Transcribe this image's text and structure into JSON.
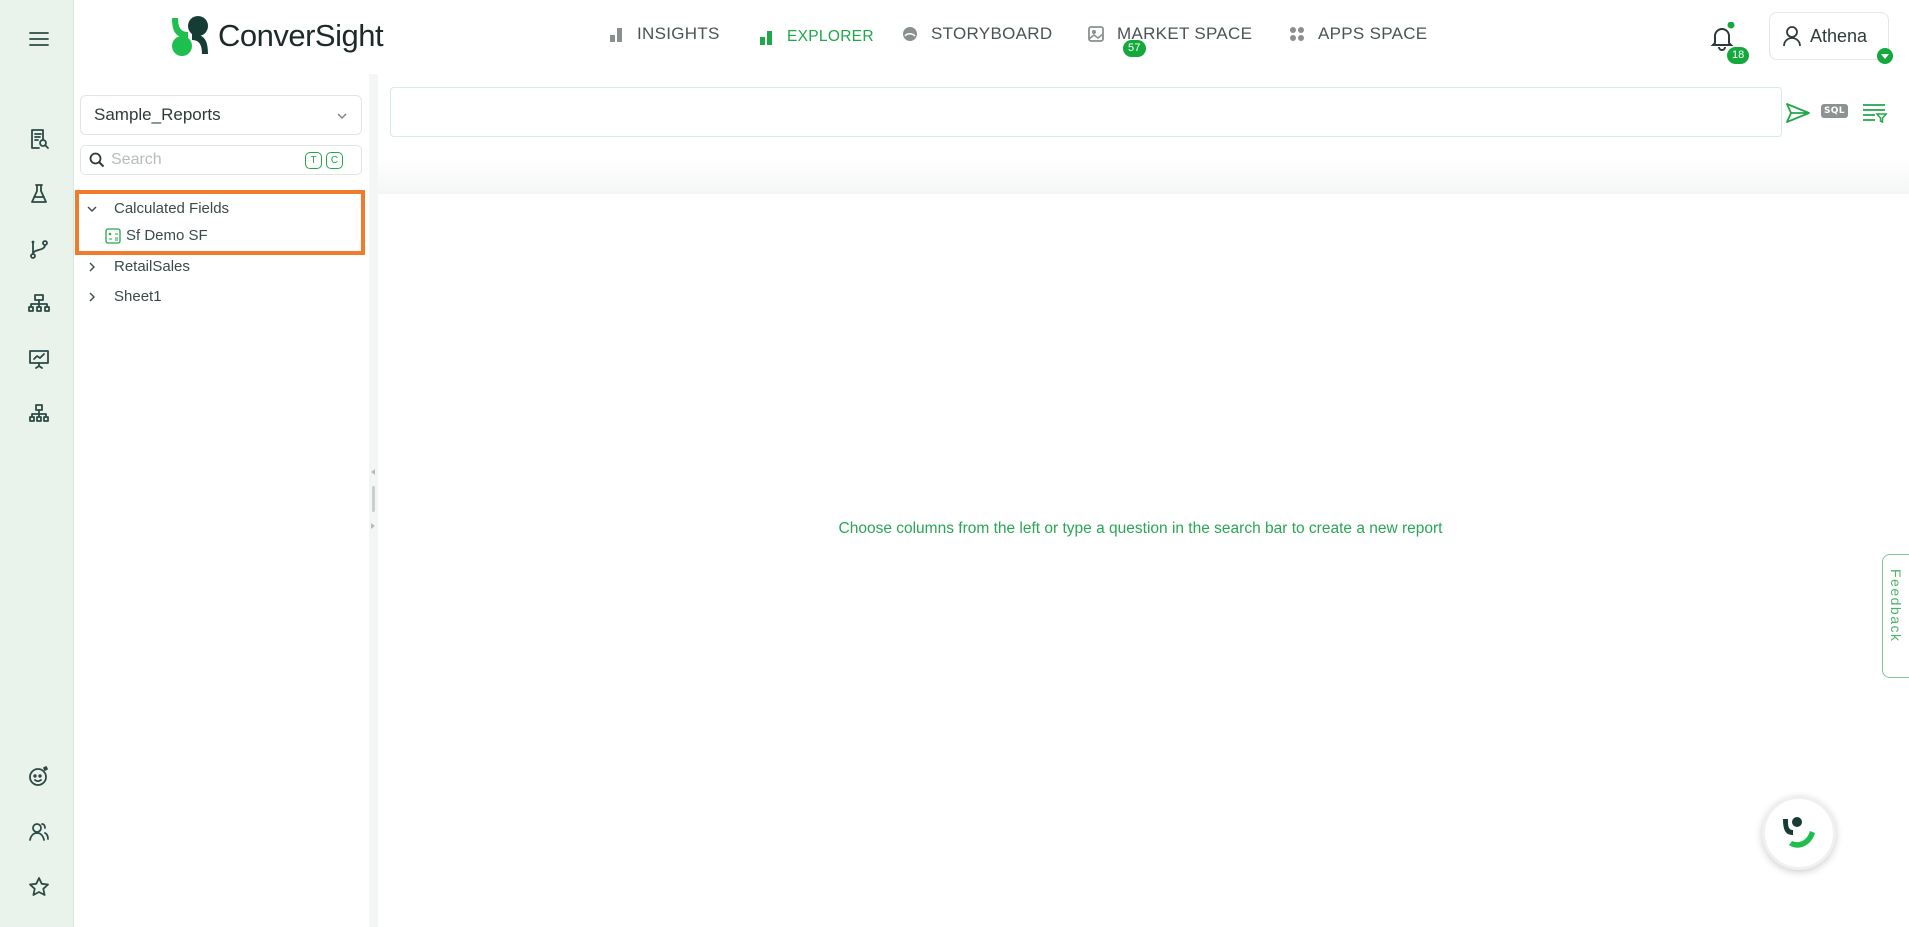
{
  "app": {
    "name": "ConverSight"
  },
  "nav": {
    "items": [
      {
        "label": "INSIGHTS",
        "icon": "bar-chart-icon"
      },
      {
        "label": "EXPLORER",
        "icon": "explorer-chart-icon",
        "active": true
      },
      {
        "label": "STORYBOARD",
        "icon": "storyboard-icon",
        "badge": "57"
      },
      {
        "label": "MARKET SPACE",
        "icon": "market-space-icon"
      },
      {
        "label": "APPS SPACE",
        "icon": "apps-grid-icon"
      }
    ]
  },
  "notifications": {
    "count": "18"
  },
  "user": {
    "name": "Athena"
  },
  "sidebar": {
    "dataset": "Sample_Reports",
    "search_placeholder": "Search",
    "search_tags": [
      "T",
      "C"
    ],
    "tree": [
      {
        "label": "Calculated Fields",
        "expanded": true,
        "children": [
          {
            "label": "Sf Demo SF"
          }
        ]
      },
      {
        "label": "RetailSales",
        "expanded": false
      },
      {
        "label": "Sheet1",
        "expanded": false
      }
    ]
  },
  "main": {
    "query_placeholder": "",
    "sql_label": "SQL",
    "empty_message": "Choose columns from the left or type a question in the search bar to create a new report"
  },
  "feedback": {
    "label": "Feedback"
  },
  "colors": {
    "accent": "#1fa84a",
    "highlight": "#f27b2b",
    "rail_bg": "#e9f3ec"
  }
}
